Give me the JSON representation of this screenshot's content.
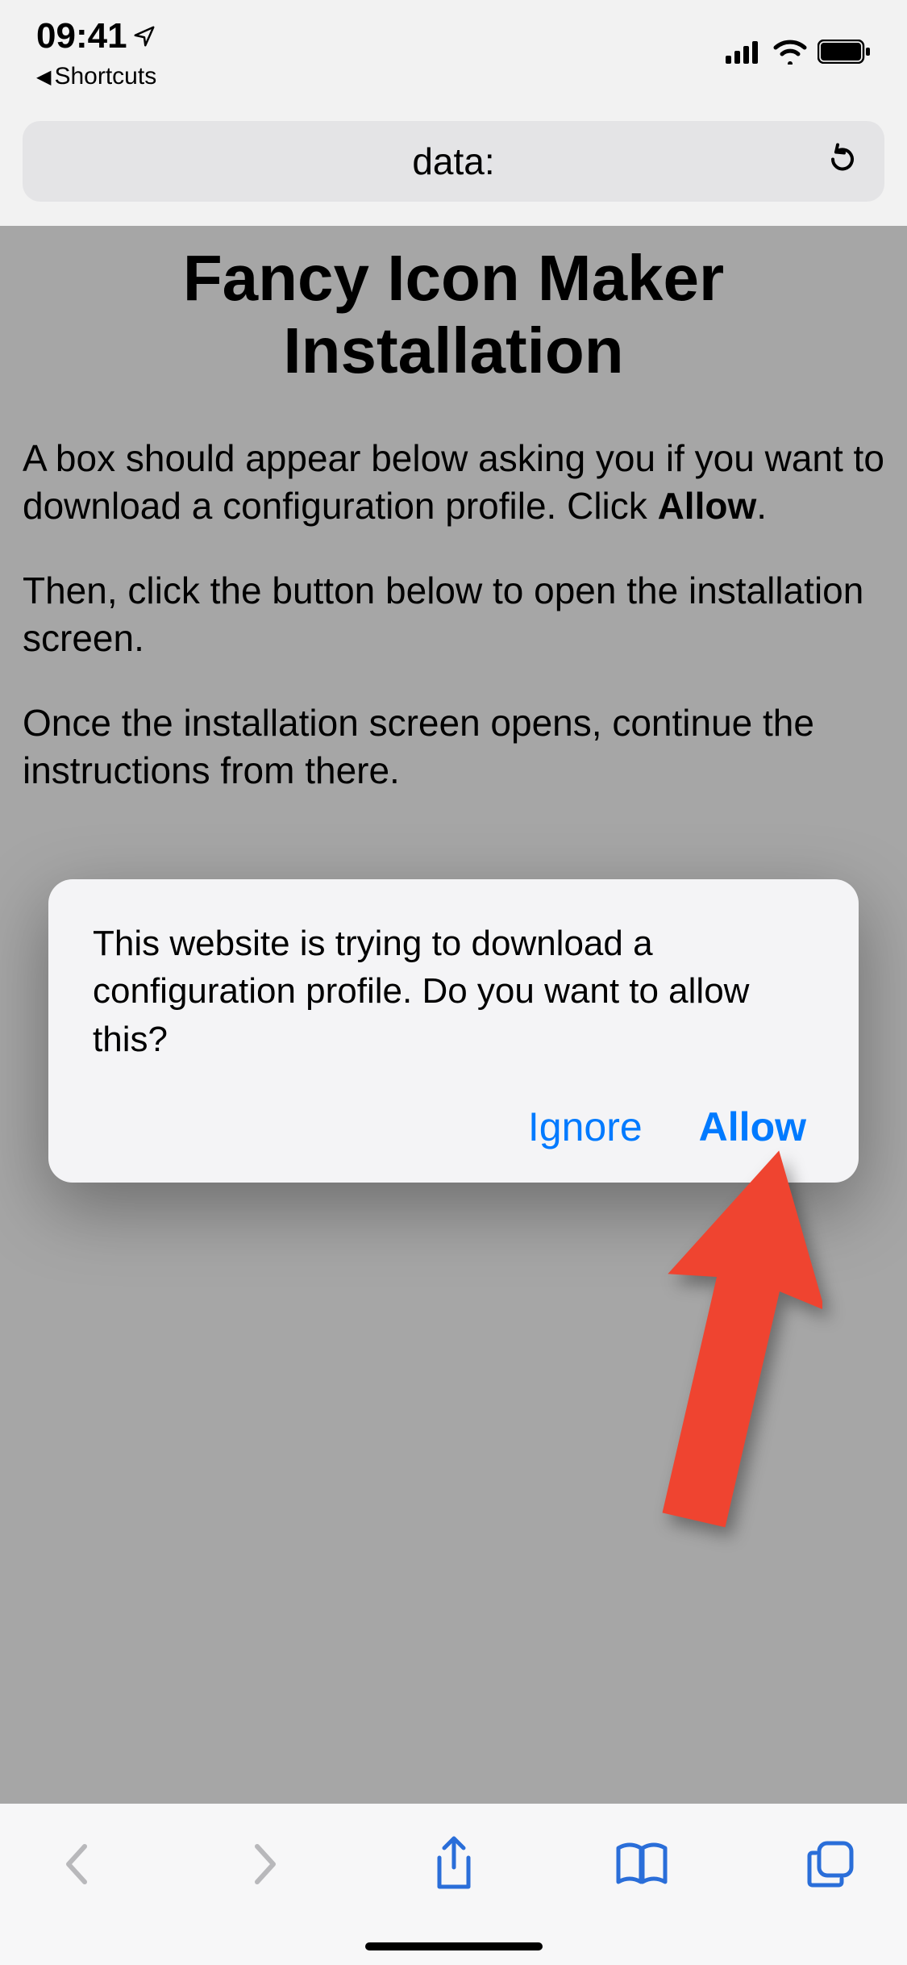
{
  "status": {
    "time": "09:41",
    "back_app_label": "Shortcuts"
  },
  "address": {
    "url_text": "data:"
  },
  "page": {
    "title": "Fancy Icon Maker Installation",
    "para1_a": "A box should appear below asking you if you want to download a configuration profile. Click ",
    "para1_b": "Allow",
    "para1_c": ".",
    "para2": "Then, click the button below to open the installation screen.",
    "para3": "Once the installation screen opens, continue the instructions from there."
  },
  "dialog": {
    "message": "This website is trying to download a configuration profile. Do you want to allow this?",
    "ignore_label": "Ignore",
    "allow_label": "Allow"
  }
}
